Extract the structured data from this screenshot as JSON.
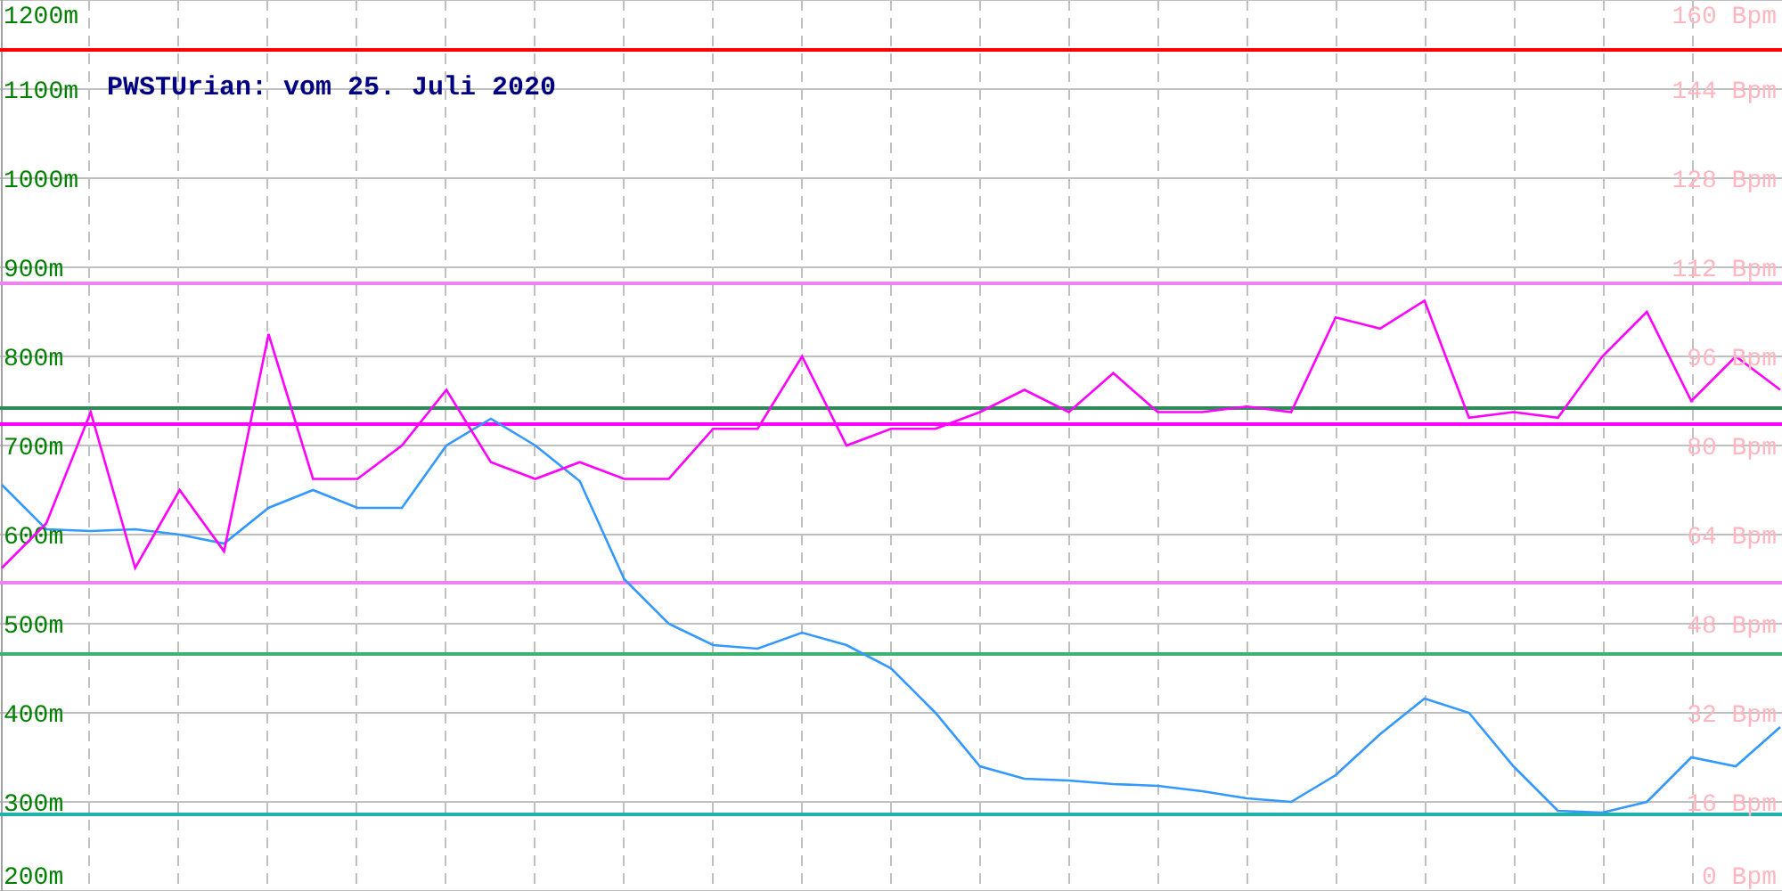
{
  "altitude_chart": {
    "chart_data": {
      "type": "line",
      "title": "PWSTUrian: vom 25. Juli 2020",
      "categories": [
        null,
        null,
        null,
        null,
        null,
        null,
        null,
        null,
        null,
        null,
        null,
        null,
        null,
        null,
        null,
        null,
        null,
        null,
        null,
        null,
        null,
        null,
        null,
        null,
        null,
        null,
        null,
        null,
        null,
        null,
        null,
        null,
        null,
        null,
        null,
        null,
        null,
        null,
        null,
        null,
        null
      ],
      "ylim": [
        200,
        1200
      ],
      "yticks": [
        {
          "value": 1200,
          "label": "1200m"
        },
        {
          "value": 1100,
          "label": "1100m"
        },
        {
          "value": 1000,
          "label": "1000m"
        },
        {
          "value": 900,
          "label": "900m"
        },
        {
          "value": 800,
          "label": "800m"
        },
        {
          "value": 700,
          "label": "700m"
        },
        {
          "value": 600,
          "label": "600m"
        },
        {
          "value": 500,
          "label": "500m"
        },
        {
          "value": 400,
          "label": "400m"
        },
        {
          "value": 300,
          "label": "300m"
        },
        {
          "value": 200,
          "label": "200m"
        }
      ],
      "series": [
        {
          "color": "#3399ff",
          "values": [
            656,
            606,
            604,
            606,
            600,
            590,
            630,
            650,
            630,
            630,
            700,
            730,
            700,
            660,
            550,
            500,
            476,
            472,
            490,
            476,
            450,
            400,
            340,
            326,
            324,
            320,
            318,
            312,
            304,
            300,
            330,
            376,
            416,
            400,
            340,
            290,
            288,
            300,
            350,
            340,
            384
          ]
        }
      ],
      "ref_lines": [
        {
          "axis": "y",
          "value": 1144,
          "color": "#ff0000"
        },
        {
          "axis": "y",
          "value": 882,
          "color": "#ee82ee"
        },
        {
          "axis": "y",
          "value": 742,
          "color": "#2e8b57"
        },
        {
          "axis": "y",
          "value": 724,
          "color": "#ff00ff"
        },
        {
          "axis": "y",
          "value": 546,
          "color": "#ee82ee"
        },
        {
          "axis": "y",
          "value": 466,
          "color": "#3cb371"
        },
        {
          "axis": "y",
          "value": 286,
          "color": "#20b2aa"
        }
      ],
      "grid": true
    }
  },
  "heart_rate_chart": {
    "chart_data": {
      "type": "line",
      "categories": [
        null,
        null,
        null,
        null,
        null,
        null,
        null,
        null,
        null,
        null,
        null,
        null,
        null,
        null,
        null,
        null,
        null,
        null,
        null,
        null,
        null,
        null,
        null,
        null,
        null,
        null,
        null,
        null,
        null,
        null,
        null,
        null,
        null,
        null,
        null,
        null,
        null,
        null,
        null,
        null,
        null
      ],
      "ylim": [
        0,
        160
      ],
      "yticks": [
        {
          "value": 160,
          "label": "160 Bpm"
        },
        {
          "value": 144,
          "label": "144 Bpm"
        },
        {
          "value": 128,
          "label": "128 Bpm"
        },
        {
          "value": 112,
          "label": "112 Bpm"
        },
        {
          "value": 96,
          "label": "96 Bpm"
        },
        {
          "value": 80,
          "label": "80 Bpm"
        },
        {
          "value": 64,
          "label": "64 Bpm"
        },
        {
          "value": 48,
          "label": "48 Bpm"
        },
        {
          "value": 32,
          "label": "32 Bpm"
        },
        {
          "value": 16,
          "label": "16 Bpm"
        },
        {
          "value": 0,
          "label": "0 Bpm"
        }
      ],
      "series": [
        {
          "color": "#ff00ff",
          "values": [
            58,
            66,
            86,
            58,
            72,
            61,
            100,
            74,
            74,
            80,
            90,
            77,
            74,
            77,
            74,
            74,
            83,
            83,
            96,
            80,
            83,
            83,
            86,
            90,
            86,
            93,
            86,
            86,
            87,
            86,
            103,
            101,
            106,
            85,
            86,
            85,
            96,
            104,
            88,
            96,
            90
          ]
        }
      ]
    }
  }
}
